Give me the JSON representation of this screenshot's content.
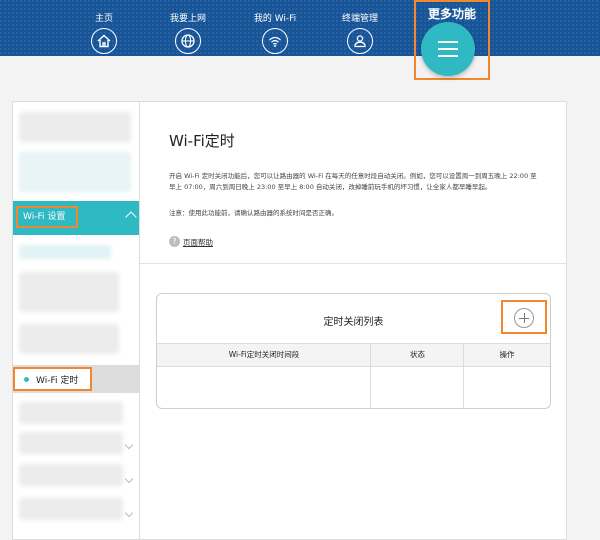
{
  "nav": {
    "items": [
      {
        "label": "主页",
        "icon": "home-icon"
      },
      {
        "label": "我要上网",
        "icon": "globe-icon"
      },
      {
        "label": "我的 Wi-Fi",
        "icon": "wifi-icon"
      },
      {
        "label": "终端管理",
        "icon": "user-icon"
      }
    ],
    "more": {
      "label": "更多功能",
      "icon": "menu-icon"
    }
  },
  "sidebar": {
    "section_label": "Wi-Fi 设置",
    "active_item": "Wi-Fi 定时"
  },
  "main": {
    "title": "Wi-Fi定时",
    "description": "开启 Wi-Fi 定时关闭功能后，您可以让路由器的 Wi-Fi 在每天的任意时段自动关闭。例如，您可以设置周一到周五晚上 22:00 至早上 07:00，周六到周日晚上 23:00 至早上 8:00 自动关闭，改掉睡前玩手机的坏习惯，让全家人都早睡早起。",
    "note": "注意：使用此功能前，请确认路由器的系统时间是否正确。",
    "help_link": "页面帮助",
    "panel": {
      "title": "定时关闭列表",
      "columns": [
        "Wi-Fi定时关闭时间段",
        "状态",
        "操作"
      ]
    }
  },
  "colors": {
    "nav_bg": "#175598",
    "accent": "#2fbac3",
    "highlight": "#f2882b"
  }
}
